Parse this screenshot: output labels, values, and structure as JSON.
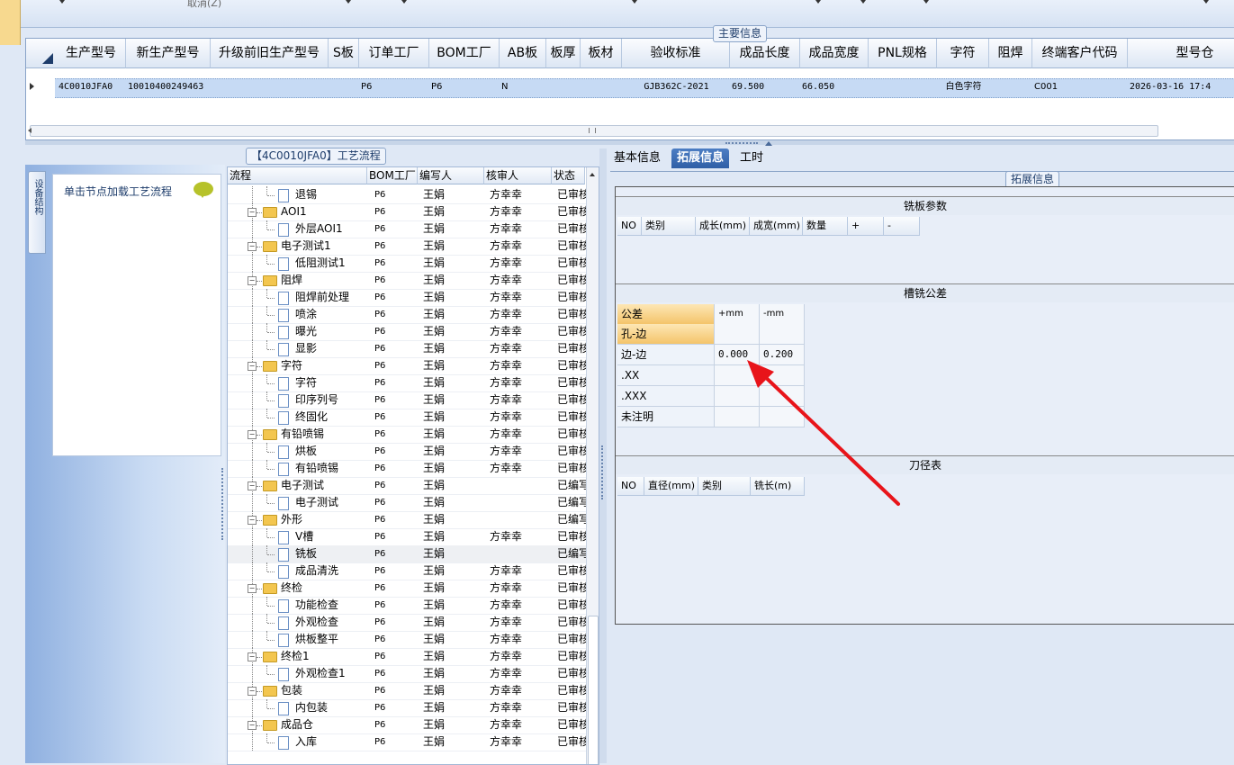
{
  "toolbar": {
    "cancel_label": "取消(Z)"
  },
  "main": {
    "group_title": "主要信息",
    "columns": [
      "生产型号",
      "新生产型号",
      "升级前旧生产型号",
      "S板",
      "订单工厂",
      "BOM工厂",
      "AB板",
      "板厚",
      "板材",
      "验收标准",
      "成品长度",
      "成品宽度",
      "PNL规格",
      "字符",
      "阻焊",
      "终端客户代码",
      "型号仓"
    ],
    "row": [
      "4C0010JFA0",
      "10010400249463",
      "",
      "",
      "P6",
      "P6",
      "N",
      "",
      "",
      "GJB362C-2021",
      "69.500",
      "66.050",
      "",
      "白色字符",
      "",
      "C001",
      "2026-03-16 17:4"
    ]
  },
  "nav": {
    "tab_label": "设备结构",
    "hint": "单击节点加载工艺流程"
  },
  "process": {
    "group_title": "【4C0010JFA0】工艺流程",
    "columns": [
      "流程",
      "BOM工厂",
      "编写人",
      "核审人",
      "状态"
    ],
    "rows": [
      {
        "name": "退锡",
        "level": 1,
        "bom": "P6",
        "writer": "王娟",
        "reviewer": "方幸幸",
        "status": "已审核"
      },
      {
        "name": "AOI1",
        "level": 0,
        "bom": "P6",
        "writer": "王娟",
        "reviewer": "方幸幸",
        "status": "已审核"
      },
      {
        "name": "外层AOI1",
        "level": 1,
        "bom": "P6",
        "writer": "王娟",
        "reviewer": "方幸幸",
        "status": "已审核"
      },
      {
        "name": "电子测试1",
        "level": 0,
        "bom": "P6",
        "writer": "王娟",
        "reviewer": "方幸幸",
        "status": "已审核"
      },
      {
        "name": "低阻测试1",
        "level": 1,
        "bom": "P6",
        "writer": "王娟",
        "reviewer": "方幸幸",
        "status": "已审核"
      },
      {
        "name": "阻焊",
        "level": 0,
        "bom": "P6",
        "writer": "王娟",
        "reviewer": "方幸幸",
        "status": "已审核"
      },
      {
        "name": "阻焊前处理",
        "level": 1,
        "bom": "P6",
        "writer": "王娟",
        "reviewer": "方幸幸",
        "status": "已审核"
      },
      {
        "name": "喷涂",
        "level": 1,
        "bom": "P6",
        "writer": "王娟",
        "reviewer": "方幸幸",
        "status": "已审核"
      },
      {
        "name": "曝光",
        "level": 1,
        "bom": "P6",
        "writer": "王娟",
        "reviewer": "方幸幸",
        "status": "已审核"
      },
      {
        "name": "显影",
        "level": 1,
        "bom": "P6",
        "writer": "王娟",
        "reviewer": "方幸幸",
        "status": "已审核"
      },
      {
        "name": "字符",
        "level": 0,
        "bom": "P6",
        "writer": "王娟",
        "reviewer": "方幸幸",
        "status": "已审核"
      },
      {
        "name": "字符",
        "level": 1,
        "bom": "P6",
        "writer": "王娟",
        "reviewer": "方幸幸",
        "status": "已审核"
      },
      {
        "name": "印序列号",
        "level": 1,
        "bom": "P6",
        "writer": "王娟",
        "reviewer": "方幸幸",
        "status": "已审核"
      },
      {
        "name": "终固化",
        "level": 1,
        "bom": "P6",
        "writer": "王娟",
        "reviewer": "方幸幸",
        "status": "已审核"
      },
      {
        "name": "有铅喷锡",
        "level": 0,
        "bom": "P6",
        "writer": "王娟",
        "reviewer": "方幸幸",
        "status": "已审核"
      },
      {
        "name": "烘板",
        "level": 1,
        "bom": "P6",
        "writer": "王娟",
        "reviewer": "方幸幸",
        "status": "已审核"
      },
      {
        "name": "有铅喷锡",
        "level": 1,
        "bom": "P6",
        "writer": "王娟",
        "reviewer": "方幸幸",
        "status": "已审核"
      },
      {
        "name": "电子测试",
        "level": 0,
        "bom": "P6",
        "writer": "王娟",
        "reviewer": "",
        "status": "已编写"
      },
      {
        "name": "电子测试",
        "level": 1,
        "bom": "P6",
        "writer": "王娟",
        "reviewer": "",
        "status": "已编写"
      },
      {
        "name": "外形",
        "level": 0,
        "bom": "P6",
        "writer": "王娟",
        "reviewer": "",
        "status": "已编写"
      },
      {
        "name": "V槽",
        "level": 1,
        "bom": "P6",
        "writer": "王娟",
        "reviewer": "方幸幸",
        "status": "已审核"
      },
      {
        "name": "铣板",
        "level": 1,
        "bom": "P6",
        "writer": "王娟",
        "reviewer": "",
        "status": "已编写",
        "selected": true
      },
      {
        "name": "成品清洗",
        "level": 1,
        "bom": "P6",
        "writer": "王娟",
        "reviewer": "方幸幸",
        "status": "已审核"
      },
      {
        "name": "终检",
        "level": 0,
        "bom": "P6",
        "writer": "王娟",
        "reviewer": "方幸幸",
        "status": "已审核"
      },
      {
        "name": "功能检查",
        "level": 1,
        "bom": "P6",
        "writer": "王娟",
        "reviewer": "方幸幸",
        "status": "已审核"
      },
      {
        "name": "外观检查",
        "level": 1,
        "bom": "P6",
        "writer": "王娟",
        "reviewer": "方幸幸",
        "status": "已审核"
      },
      {
        "name": "烘板整平",
        "level": 1,
        "bom": "P6",
        "writer": "王娟",
        "reviewer": "方幸幸",
        "status": "已审核"
      },
      {
        "name": "终检1",
        "level": 0,
        "bom": "P6",
        "writer": "王娟",
        "reviewer": "方幸幸",
        "status": "已审核"
      },
      {
        "name": "外观检查1",
        "level": 1,
        "bom": "P6",
        "writer": "王娟",
        "reviewer": "方幸幸",
        "status": "已审核"
      },
      {
        "name": "包装",
        "level": 0,
        "bom": "P6",
        "writer": "王娟",
        "reviewer": "方幸幸",
        "status": "已审核"
      },
      {
        "name": "内包装",
        "level": 1,
        "bom": "P6",
        "writer": "王娟",
        "reviewer": "方幸幸",
        "status": "已审核"
      },
      {
        "name": "成品仓",
        "level": 0,
        "bom": "P6",
        "writer": "王娟",
        "reviewer": "方幸幸",
        "status": "已审核"
      },
      {
        "name": "入库",
        "level": 1,
        "bom": "P6",
        "writer": "王娟",
        "reviewer": "方幸幸",
        "status": "已审核"
      }
    ]
  },
  "tabs": [
    {
      "label": "基本信息",
      "active": false
    },
    {
      "label": "拓展信息",
      "active": true
    },
    {
      "label": "工时",
      "active": false
    }
  ],
  "ext": {
    "group_title": "拓展信息",
    "mill_params": {
      "title": "铣板参数",
      "columns": [
        "NO",
        "类别",
        "成长(mm)",
        "成宽(mm)",
        "数量",
        "+",
        "-"
      ]
    },
    "tolerance": {
      "title": "槽铣公差",
      "columns": [
        "公差",
        "+mm",
        "-mm"
      ],
      "rows": [
        {
          "label": "孔-边",
          "plus": "",
          "minus": ""
        },
        {
          "label": "边-边",
          "plus": "0.000",
          "minus": "0.200"
        },
        {
          "label": ".XX",
          "plus": "",
          "minus": ""
        },
        {
          "label": ".XXX",
          "plus": "",
          "minus": ""
        },
        {
          "label": "未注明",
          "plus": "",
          "minus": ""
        }
      ]
    },
    "tool_table": {
      "title": "刀径表",
      "columns": [
        "NO",
        "直径(mm)",
        "类别",
        "铣长(m)"
      ]
    }
  },
  "colors": {
    "arrow": "#e8141a",
    "selected_row": "#c6daf4",
    "active_tab": "#3a6bb3"
  }
}
